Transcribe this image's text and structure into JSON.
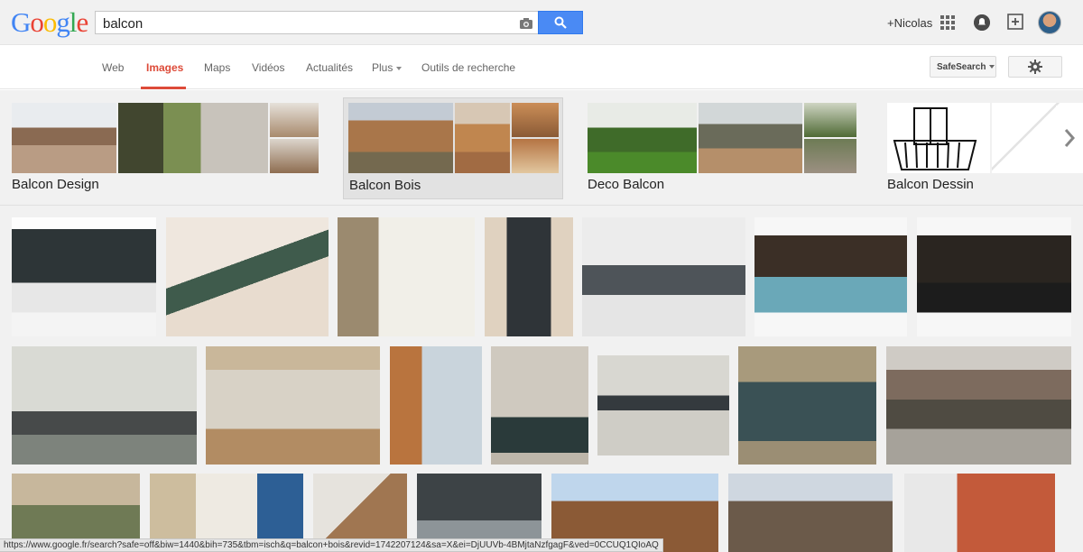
{
  "header": {
    "logo_letters": [
      {
        "ch": "G",
        "color": "#4285f4"
      },
      {
        "ch": "o",
        "color": "#ea4335"
      },
      {
        "ch": "o",
        "color": "#fbbc05"
      },
      {
        "ch": "g",
        "color": "#4285f4"
      },
      {
        "ch": "l",
        "color": "#34a853"
      },
      {
        "ch": "e",
        "color": "#ea4335"
      }
    ],
    "search_query": "balcon",
    "user_name": "+Nicolas"
  },
  "nav": {
    "items": [
      {
        "label": "Web",
        "active": false
      },
      {
        "label": "Images",
        "active": true
      },
      {
        "label": "Maps",
        "active": false
      },
      {
        "label": "Vidéos",
        "active": false
      },
      {
        "label": "Actualités",
        "active": false
      },
      {
        "label": "Plus",
        "active": false,
        "dropdown": true
      },
      {
        "label": "Outils de recherche",
        "active": false
      }
    ],
    "safesearch_label": "SafeSearch",
    "accent_color": "#dd4b39"
  },
  "related_searches": [
    {
      "label": "Balcon Design",
      "selected": false
    },
    {
      "label": "Balcon Bois",
      "selected": true
    },
    {
      "label": "Deco Balcon",
      "selected": false
    },
    {
      "label": "Balcon Dessin",
      "selected": false
    }
  ],
  "results": {
    "row_count": 3,
    "thumbnails": [
      {
        "row": 0,
        "subject": "white railing balcony with plants"
      },
      {
        "row": 0,
        "subject": "green iron railing balcony"
      },
      {
        "row": 0,
        "subject": "white railing balcony with shutters"
      },
      {
        "row": 0,
        "subject": "french window with railing"
      },
      {
        "row": 0,
        "subject": "ornate iron balcony with lamps"
      },
      {
        "row": 0,
        "subject": "blue railing balcony with plants"
      },
      {
        "row": 0,
        "subject": "black iron balcony with flowers"
      },
      {
        "row": 1,
        "subject": "glass balcony"
      },
      {
        "row": 1,
        "subject": "stone balustrade balcony"
      },
      {
        "row": 1,
        "subject": "rounded balcony on wood facade"
      },
      {
        "row": 1,
        "subject": "stone facade wrought iron balcony"
      },
      {
        "row": 1,
        "subject": "haussmann balcony"
      },
      {
        "row": 1,
        "subject": "curved wrought iron balcony"
      },
      {
        "row": 1,
        "subject": "old wooden balcony"
      },
      {
        "row": 2,
        "subject": "balcony with palm tree"
      },
      {
        "row": 2,
        "subject": "blue balcony railing"
      },
      {
        "row": 2,
        "subject": "wooden trellis balcony"
      },
      {
        "row": 2,
        "subject": "round dark balcony"
      },
      {
        "row": 2,
        "subject": "wooden roof balcony"
      },
      {
        "row": 2,
        "subject": "terrace with parasol"
      },
      {
        "row": 2,
        "subject": "brick building balconies"
      }
    ]
  },
  "status_bar": {
    "url": "https://www.google.fr/search?safe=off&biw=1440&bih=735&tbm=isch&q=balcon+bois&revid=1742207124&sa=X&ei=DjUUVb-4BMjtaNzfgagF&ved=0CCUQ1QIoAQ"
  }
}
